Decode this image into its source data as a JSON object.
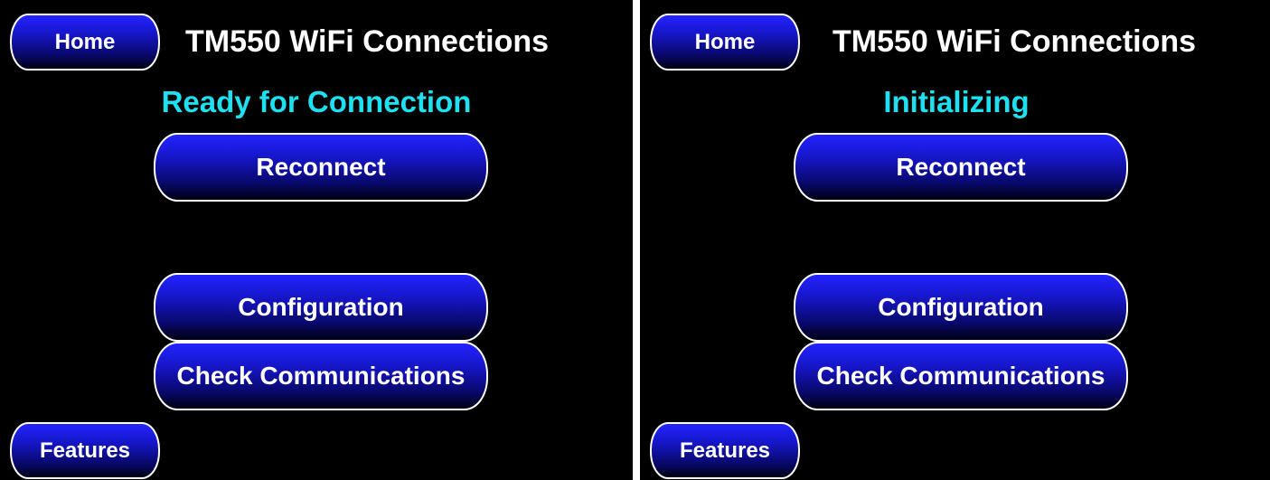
{
  "colors": {
    "background": "#000000",
    "button_top": "#2323ff",
    "button_bottom": "#000012",
    "button_border": "#ffffff",
    "status_text": "#1ee0f0",
    "text": "#ffffff"
  },
  "screens": [
    {
      "home_label": "Home",
      "title": "TM550 WiFi Connections",
      "status": "Ready for Connection",
      "reconnect_label": "Reconnect",
      "configuration_label": "Configuration",
      "check_communications_label": "Check Communications",
      "features_label": "Features"
    },
    {
      "home_label": "Home",
      "title": "TM550 WiFi Connections",
      "status": "Initializing",
      "reconnect_label": "Reconnect",
      "configuration_label": "Configuration",
      "check_communications_label": "Check Communications",
      "features_label": "Features"
    }
  ]
}
